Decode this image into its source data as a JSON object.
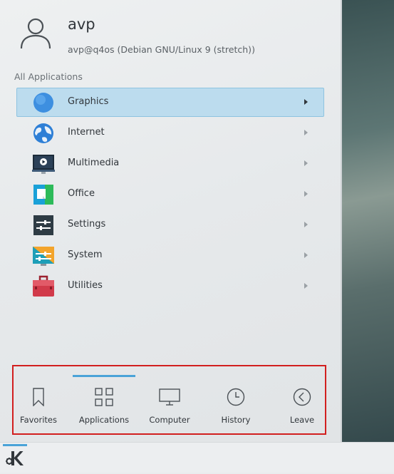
{
  "user": {
    "name": "avp",
    "host": "avp@q4os (Debian GNU/Linux 9 (stretch))"
  },
  "section_label": "All Applications",
  "apps": [
    {
      "label": "Graphics",
      "icon": "graphics-icon",
      "selected": true
    },
    {
      "label": "Internet",
      "icon": "internet-icon",
      "selected": false
    },
    {
      "label": "Multimedia",
      "icon": "multimedia-icon",
      "selected": false
    },
    {
      "label": "Office",
      "icon": "office-icon",
      "selected": false
    },
    {
      "label": "Settings",
      "icon": "settings-icon",
      "selected": false
    },
    {
      "label": "System",
      "icon": "system-icon",
      "selected": false
    },
    {
      "label": "Utilities",
      "icon": "utilities-icon",
      "selected": false
    }
  ],
  "tabs": [
    {
      "label": "Favorites",
      "icon": "bookmark-icon",
      "active": false
    },
    {
      "label": "Applications",
      "icon": "grid-icon",
      "active": true
    },
    {
      "label": "Computer",
      "icon": "monitor-icon",
      "active": false
    },
    {
      "label": "History",
      "icon": "clock-icon",
      "active": false
    },
    {
      "label": "Leave",
      "icon": "back-arrow-icon",
      "active": false
    }
  ],
  "colors": {
    "accent": "#4aa3d8",
    "selection": "#bcdcee",
    "highlight_border": "#d21f1f"
  }
}
